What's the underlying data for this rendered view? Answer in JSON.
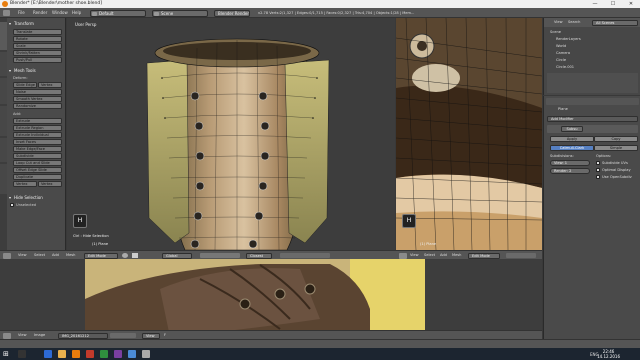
{
  "window": {
    "title": "Blender* [E:\\Blender\\mother shoe.blend]",
    "min": "—",
    "max": "☐",
    "close": "✕"
  },
  "topmenu": {
    "file": "File",
    "render": "Render",
    "window": "Window",
    "help": "Help"
  },
  "topbar": {
    "layout": "Default",
    "scene": "Scene",
    "engine": "Blender Render",
    "version": "v2.78",
    "stats": "Verts:2/1,327 | Edges:0/1,715 | Faces:0/2,327 | Tris:4,704 | Objects:1/28 | Mem..."
  },
  "toolshelf": {
    "tabs": [
      "Tools",
      "Create",
      "Relations",
      "Shading / UVs",
      "Options",
      "Grease Pencil"
    ],
    "transform_header": "Transform",
    "transform_buttons": [
      "Translate",
      "Rotate",
      "Scale",
      "Shrink/Fatten",
      "Push/Pull"
    ],
    "meshtools_header": "Mesh Tools",
    "deform_label": "Deform:",
    "deform_buttons": [
      "Slide Edge",
      "Vertex",
      "Noise",
      "Smooth Vertex",
      "Randomize"
    ],
    "add_label": "Add:",
    "add_buttons": [
      "Extrude",
      "Extrude Region",
      "Extrude Individual",
      "Inset Faces",
      "Make Edge/Face",
      "Subdivide",
      "Loop Cut and Slide",
      "Offset Edge Slide",
      "Duplicate"
    ],
    "slide_buttons": [
      "Vertex",
      "Vertex"
    ],
    "hide_header": "Hide Selection",
    "unselected_label": "Unselected"
  },
  "vp_main": {
    "label": "User Persp",
    "operator": "Ctrl : Hide Selection",
    "object": "(1) Plane",
    "key_hint": "H"
  },
  "vp_right": {
    "object": "(1) Plane",
    "key_hint": "H"
  },
  "vp_header_main": {
    "view": "View",
    "select": "Select",
    "add": "Add",
    "mesh": "Mesh",
    "mode": "Edit Mode",
    "pivot": "Global",
    "snap": "Closest"
  },
  "vp_header_right": {
    "view": "View",
    "select": "Select",
    "add": "Add",
    "mesh": "Mesh",
    "mode": "Edit Mode"
  },
  "image_header": {
    "view": "View",
    "image": "Image",
    "file": "IMG_20161212",
    "view2": "View",
    "f": "F"
  },
  "outliner": {
    "view": "View",
    "search": "Search",
    "all_scenes": "All Scenes",
    "items": [
      "Scene",
      "RenderLayers",
      "World",
      "Camera",
      "Circle",
      "Circle.001"
    ]
  },
  "props": {
    "object": "Plane",
    "add_modifier": "Add Modifier",
    "subsurf": "Subsu",
    "apply": "Apply",
    "copy": "Copy",
    "catmull": "Catmull-Clark",
    "simple": "Simple",
    "subdivisions_label": "Subdivisions:",
    "options_label": "Options:",
    "view_field": "View:",
    "view_value": "1",
    "render_field": "Render:",
    "render_value": "2",
    "opt1": "Subdivide UVs",
    "opt2": "Optimal Display",
    "opt3": "Use OpenSubdiv"
  },
  "clock": {
    "time": "22:46",
    "date": "14.12.2016",
    "lang": "ENG"
  },
  "colors": {
    "accent": "#5680c2",
    "active_blue": "#3f6fbf",
    "bg": "#393939"
  }
}
